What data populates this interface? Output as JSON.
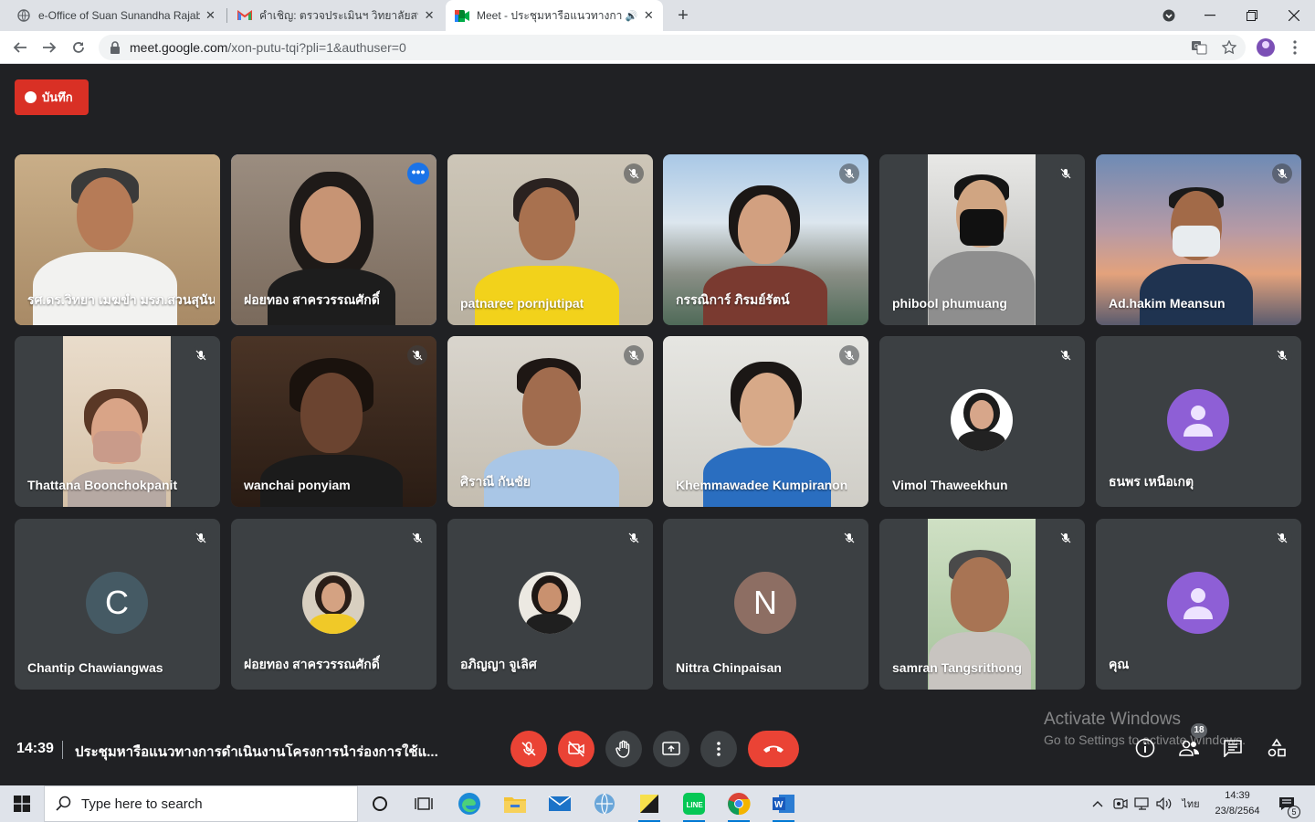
{
  "browser": {
    "tabs": [
      {
        "title": "e-Office of Suan Sunandha Rajabhat University",
        "icon": "globe-icon"
      },
      {
        "title": "คำเชิญ: ตรวจประเมินฯ วิทยาลัยสหเวชศาสตร์",
        "icon": "gmail-icon"
      },
      {
        "title": "Meet - ประชุมหารือแนวทางการดำเนินงาน",
        "icon": "meet-icon"
      }
    ],
    "url_host": "meet.google.com",
    "url_path": "/xon-putu-tqi?pli=1&authuser=0"
  },
  "meet": {
    "record_label": "บันทึก",
    "participants": [
      {
        "name": "รศ.ดร.วิทยา เมฆขำ มรภ.สวนสุนันทา",
        "muted": false
      },
      {
        "name": "ฝอยทอง สาครวรรณศักดิ์",
        "muted": false
      },
      {
        "name": "patnaree pornjutipat",
        "muted": true
      },
      {
        "name": "กรรณิการ์ ภิรมย์รัตน์",
        "muted": true
      },
      {
        "name": "phibool phumuang",
        "muted": true
      },
      {
        "name": "Ad.hakim Meansun",
        "muted": true
      },
      {
        "name": "Thattana Boonchokpanit",
        "muted": true
      },
      {
        "name": "wanchai ponyiam",
        "muted": true
      },
      {
        "name": "ศิราณี กันชัย",
        "muted": true
      },
      {
        "name": "Khemmawadee Kumpiranon",
        "muted": true
      },
      {
        "name": "Vimol Thaweekhun",
        "muted": true
      },
      {
        "name": "ธนพร เหนือเกตุ",
        "muted": true
      },
      {
        "name": "Chantip Chawiangwas",
        "muted": true,
        "initial": "C"
      },
      {
        "name": "ฝอยทอง สาครวรรณศักดิ์",
        "muted": true
      },
      {
        "name": "อภิญญา จูเลิศ",
        "muted": true
      },
      {
        "name": "Nittra Chinpaisan",
        "muted": true,
        "initial": "N"
      },
      {
        "name": "samran Tangsrithong",
        "muted": true
      },
      {
        "name": "คุณ",
        "muted": true
      }
    ],
    "time": "14:39",
    "meeting_title": "ประชุมหารือแนวทางการดำเนินงานโครงการนำร่องการใช้แ...",
    "people_count": "18",
    "activate_title": "Activate Windows",
    "activate_sub": "Go to Settings to activate Windows.",
    "colors": {
      "red": "#ea4335",
      "tile": "#3c4043",
      "bg": "#202124",
      "accent": "#8ab4f8"
    }
  },
  "taskbar": {
    "search_placeholder": "Type here to search",
    "lang": "ไทย",
    "time": "14:39",
    "date": "23/8/2564",
    "notifications": "5"
  }
}
